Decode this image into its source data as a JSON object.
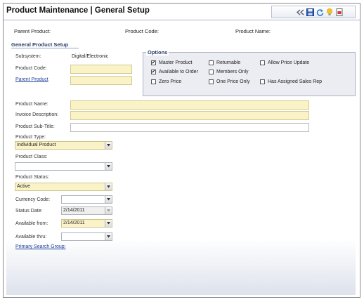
{
  "title": "Product Maintenance  |  General Setup",
  "summary": {
    "parent_product": "Parent Product:",
    "product_code": "Product Code:",
    "product_name": "Product Name:"
  },
  "section_title": "General Product Setup",
  "subsystem": {
    "label": "Subsystem:",
    "value": "Digital/Electronic"
  },
  "product_code": {
    "label": "Product Code:",
    "value": ""
  },
  "parent_product": {
    "label": "Parent Product",
    "value": ""
  },
  "options": {
    "title": "Options",
    "items": [
      {
        "label": "Master Product",
        "checked": "✔"
      },
      {
        "label": "Returnable",
        "checked": ""
      },
      {
        "label": "Allow Price Update",
        "checked": ""
      },
      {
        "label": "Available to Order",
        "checked": "✔"
      },
      {
        "label": "Members Only",
        "checked": ""
      },
      {
        "label": "Zero Price",
        "checked": ""
      },
      {
        "label": "One Price Only",
        "checked": ""
      },
      {
        "label": "Has Assigned Sales Rep",
        "checked": ""
      }
    ]
  },
  "product_name": {
    "label": "Product Name:",
    "value": ""
  },
  "invoice_description": {
    "label": "Invoice Description:",
    "value": ""
  },
  "product_subtitle": {
    "label": "Product Sub-Title:",
    "value": ""
  },
  "product_type": {
    "label": "Product Type:",
    "value": "Individual Product"
  },
  "product_class": {
    "label": "Product Class:",
    "value": ""
  },
  "product_status": {
    "label": "Product Status:",
    "value": "Active"
  },
  "currency_code": {
    "label": "Currency Code:",
    "value": ""
  },
  "status_date": {
    "label": "Status Date:",
    "value": "2/14/2011"
  },
  "available_from": {
    "label": "Available from:",
    "value": "2/14/2011"
  },
  "available_thru": {
    "label": "Available thru:",
    "value": ""
  },
  "primary_search_group": "Primary Search Group:",
  "colors": {
    "required_bg": "#fbf3c8",
    "link": "#1f3c99",
    "section": "#2a3e6a"
  }
}
